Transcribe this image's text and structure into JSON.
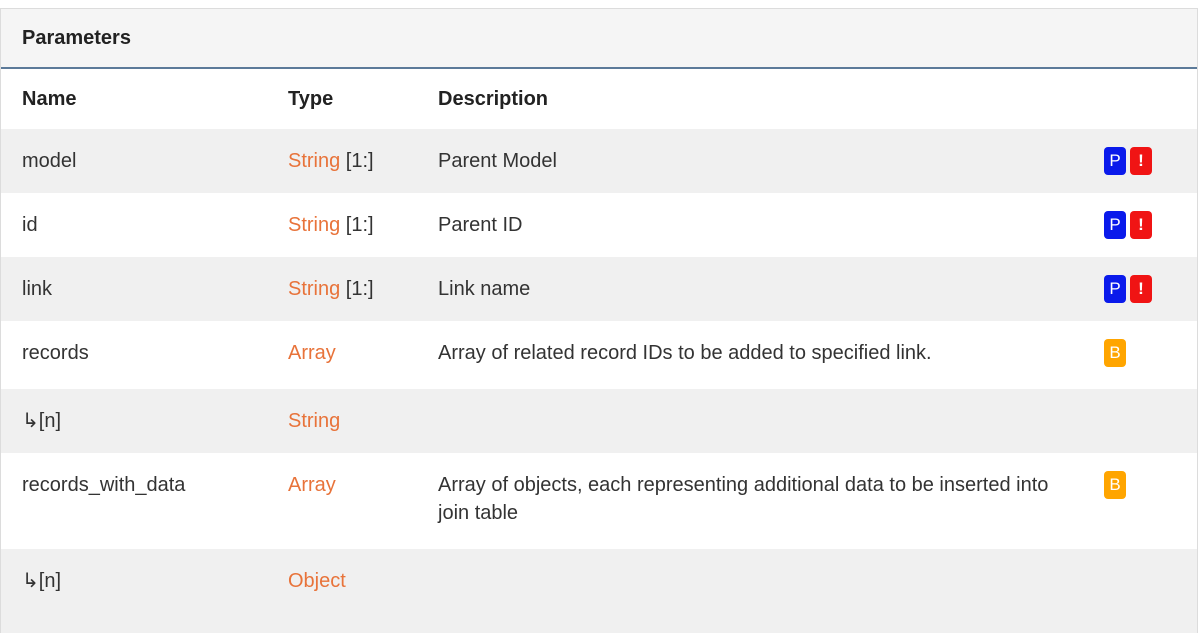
{
  "panel": {
    "title": "Parameters"
  },
  "columns": {
    "name": "Name",
    "type": "Type",
    "description": "Description"
  },
  "rows": [
    {
      "name": "model",
      "type": "String",
      "range": " [1:]",
      "description": "Parent Model",
      "badges": [
        "P",
        "!"
      ]
    },
    {
      "name": "id",
      "type": "String",
      "range": " [1:]",
      "description": "Parent ID",
      "badges": [
        "P",
        "!"
      ]
    },
    {
      "name": "link",
      "type": "String",
      "range": " [1:]",
      "description": "Link name",
      "badges": [
        "P",
        "!"
      ]
    },
    {
      "name": "records",
      "type": "Array",
      "range": "",
      "description": "Array of related record IDs to be added to specified link.",
      "badges": [
        "B"
      ]
    },
    {
      "name": "↳[n]",
      "type": "String",
      "range": "",
      "description": "",
      "badges": []
    },
    {
      "name": "records_with_data",
      "type": "Array",
      "range": "",
      "description": "Array of objects, each representing additional data to be inserted into join table",
      "badges": [
        "B"
      ]
    },
    {
      "name": "↳[n]",
      "type": "Object",
      "range": "",
      "description": "",
      "badges": []
    }
  ],
  "colors": {
    "type_accent": "#e8733a",
    "badge_p": "#0a1aeb",
    "badge_required": "#f01414",
    "badge_b": "#ffa500",
    "header_rule": "#5c7a99"
  }
}
